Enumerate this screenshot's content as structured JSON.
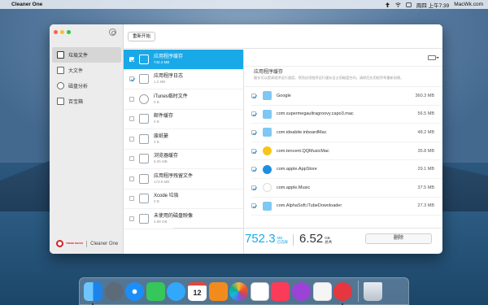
{
  "menubar": {
    "app_name": "Cleaner One",
    "datetime": "周四 上午7:39",
    "site": "MacWk.com"
  },
  "sidebar": {
    "items": [
      {
        "label": "垃圾文件",
        "icon": "trash-bin-icon",
        "active": true
      },
      {
        "label": "大文件",
        "icon": "document-icon",
        "active": false
      },
      {
        "label": "磁盘分析",
        "icon": "disk-icon",
        "active": false
      },
      {
        "label": "百宝箱",
        "icon": "toolbox-icon",
        "active": false
      }
    ],
    "brand_name": "Cleaner One",
    "brand_logo_text": "TREND MICRO"
  },
  "toolbar": {
    "rescan_label": "重新开始"
  },
  "categories": [
    {
      "name": "应用程序缓存",
      "size": "742.4 MB",
      "checked": true,
      "selected": true
    },
    {
      "name": "应用程序日志",
      "size": "1.2 MB",
      "checked": true,
      "selected": false
    },
    {
      "name": "iTunes临时文件",
      "size": "0 B",
      "checked": false,
      "selected": false
    },
    {
      "name": "邮件缓存",
      "size": "0 B",
      "checked": false,
      "selected": false
    },
    {
      "name": "废纸篓",
      "size": "0 B",
      "checked": false,
      "selected": false
    },
    {
      "name": "浏览器缓存",
      "size": "6.05 MB",
      "checked": false,
      "selected": false
    },
    {
      "name": "应用程序残留文件",
      "size": "173.8 MB",
      "checked": false,
      "selected": false
    },
    {
      "name": "Xcode 垃圾",
      "size": "0 B",
      "checked": false,
      "selected": false
    },
    {
      "name": "未使用的磁盘映像",
      "size": "4.98 GB",
      "checked": false,
      "selected": false
    }
  ],
  "detail": {
    "title": "应用程序缓存",
    "description": "缓存可以提高程序运行速度，然而应用程序运行缓存会占用磁盘空间，清除后应用程序将重新创建。",
    "items": [
      {
        "name": "Google",
        "size": "360.3 MB",
        "icon": "folder-icon",
        "color": "#7ec8f2"
      },
      {
        "name": "com.supermegaultragroovy.capo3.mac",
        "size": "56.5 MB",
        "icon": "folder-icon",
        "color": "#7ec8f2"
      },
      {
        "name": "com.ideabite.inboardMac",
        "size": "48.2 MB",
        "icon": "folder-icon",
        "color": "#7ec8f2"
      },
      {
        "name": "com.tencent.QQMusicMac",
        "size": "35.8 MB",
        "icon": "qqmusic-icon",
        "color": "#f5c518"
      },
      {
        "name": "com.apple.AppStore",
        "size": "29.1 MB",
        "icon": "appstore-icon",
        "color": "#1d8fe0"
      },
      {
        "name": "com.apple.Music",
        "size": "37.5 MB",
        "icon": "music-icon",
        "color": "#ffffff"
      },
      {
        "name": "com.AlphaSoft.iTubeDownloader",
        "size": "27.3 MB",
        "icon": "folder-icon",
        "color": "#7ec8f2"
      }
    ]
  },
  "footer": {
    "selected_value": "752.3",
    "selected_unit": "MB",
    "selected_label": "已选择",
    "total_value": "6.52",
    "total_unit": "GB",
    "total_label": "总共",
    "delete_label": "删除"
  },
  "dock": [
    {
      "name": "finder-icon",
      "color": "#2a9df4"
    },
    {
      "name": "launchpad-icon",
      "color": "#6b7785"
    },
    {
      "name": "safari-icon",
      "color": "#1c8ef9"
    },
    {
      "name": "facetime-icon",
      "color": "#35c759"
    },
    {
      "name": "messages-icon",
      "color": "#31a8fa"
    },
    {
      "name": "calendar-icon",
      "color": "#ffffff"
    },
    {
      "name": "books-icon",
      "color": "#f28b1d"
    },
    {
      "name": "photos-icon",
      "color": "#f6f6f6"
    },
    {
      "name": "reminders-icon",
      "color": "#ffffff"
    },
    {
      "name": "music-icon",
      "color": "#fb3b58"
    },
    {
      "name": "podcasts-icon",
      "color": "#9b43d6"
    },
    {
      "name": "kuaikan-icon",
      "color": "#f5f5f5"
    },
    {
      "name": "cleaner-one-icon",
      "color": "#e6363f"
    },
    {
      "name": "trash-icon",
      "color": "#c9d2da"
    }
  ],
  "calendar_day": "12"
}
